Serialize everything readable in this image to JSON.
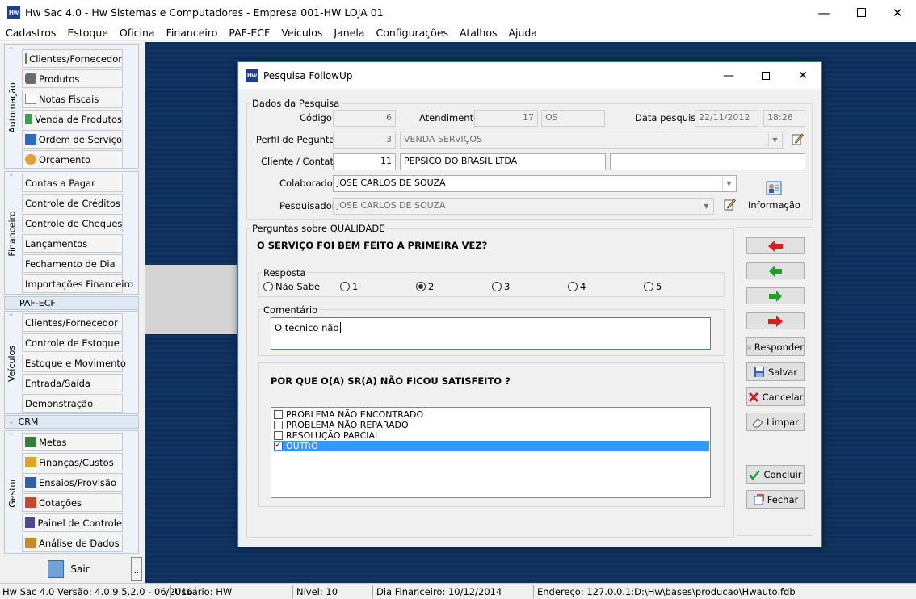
{
  "window": {
    "title": "Hw Sac 4.0 - Hw Sistemas e Computadores - Empresa 001-HW LOJA 01",
    "icon_text": "Hw",
    "controls": [
      "minimize-icon",
      "maximize-icon",
      "close-icon"
    ]
  },
  "menu": [
    "Cadastros",
    "Estoque",
    "Oficina",
    "Financeiro",
    "PAF-ECF",
    "Veículos",
    "Janela",
    "Configurações",
    "Atalhos",
    "Ajuda"
  ],
  "sidebar": {
    "groups": [
      {
        "label": "Automação",
        "items": [
          "Clientes/Fornecedor",
          "Produtos",
          "Notas Fiscais",
          "Venda de Produtos",
          "Ordem de Serviço",
          "Orçamento"
        ]
      },
      {
        "label": "Financeiro",
        "items": [
          "Contas a Pagar",
          "Controle de Créditos",
          "Controle de Cheques",
          "Lançamentos",
          "Fechamento de Dia",
          "Importações Financeiro"
        ]
      },
      {
        "label": "PAF-ECF"
      },
      {
        "label": "Veículos",
        "items": [
          "Clientes/Fornecedor",
          "Controle de Estoque",
          "Estoque e Movimento",
          "Entrada/Saída",
          "Demonstração"
        ]
      },
      {
        "label": "CRM"
      },
      {
        "label": "Gestor",
        "items": [
          "Metas",
          "Finanças/Custos",
          "Ensaios/Provisão",
          "Cotações",
          "Painel de Controle",
          "Análise de Dados"
        ]
      }
    ],
    "exit_label": "Sair",
    "more_label": ".."
  },
  "statusbar": {
    "version": "Hw Sac 4.0 Versão: 4.0.9.5.2.0 - 06/2016",
    "user": "Usuário: HW",
    "level": "Nível: 10",
    "fin_day": "Dia Financeiro: 10/12/2014",
    "address": "Endereço: 127.0.0.1:D:\\Hw\\bases\\producao\\Hwauto.fdb"
  },
  "dialog": {
    "title": "Pesquisa FollowUp",
    "search_section": {
      "legend": "Dados da Pesquisa",
      "codigo_label": "Código",
      "codigo": "6",
      "atendimento_label": "Atendimento",
      "atendimento": "17",
      "atendimento_tipo": "OS",
      "data_label": "Data pesquisa",
      "data": "22/11/2012",
      "hora": "18:26",
      "perfil_label": "Perfil de Peguntas",
      "perfil_id": "3",
      "perfil": "VENDA SERVIÇOS",
      "cliente_label": "Cliente / Contato",
      "cliente_id": "11",
      "cliente": "PEPSICO DO BRASIL LTDA",
      "contato": "",
      "colaborador_label": "Colaborador",
      "colaborador": "JOSE CARLOS DE SOUZA",
      "pesquisador_label": "Pesquisador",
      "pesquisador": "JOSE CARLOS DE SOUZA",
      "info_label": "Informação"
    },
    "questions_section": {
      "legend": "Perguntas sobre QUALIDADE",
      "question": "O SERVIÇO FOI BEM FEITO A PRIMEIRA VEZ?",
      "resposta_legend": "Resposta",
      "options": [
        "Não Sabe",
        "1",
        "2",
        "3",
        "4",
        "5"
      ],
      "selected_option": "2",
      "comentario_legend": "Comentário",
      "comentario": "O técnico não",
      "followup_question": "POR QUE O(A) SR(A) NÃO FICOU SATISFEITO ?",
      "reasons": [
        {
          "label": "PROBLEMA NÃO ENCONTRADO",
          "checked": false,
          "selected": false
        },
        {
          "label": "PROBLEMA NÃO REPARADO",
          "checked": false,
          "selected": false
        },
        {
          "label": "RESOLUÇÃO PARCIAL",
          "checked": false,
          "selected": false
        },
        {
          "label": "OUTRO",
          "checked": true,
          "selected": true
        }
      ]
    },
    "buttons": {
      "responder": "Responder",
      "salvar": "Salvar",
      "cancelar": "Cancelar",
      "limpar": "Limpar",
      "concluir": "Concluir",
      "fechar": "Fechar"
    },
    "nav_buttons": [
      "first-record-icon",
      "previous-record-icon",
      "next-record-icon",
      "last-record-icon"
    ]
  },
  "colors": {
    "accent": "#3399ff",
    "mdi_background": "#0e2e58",
    "nav_red": "#d62020",
    "nav_green": "#1e9e2a"
  }
}
